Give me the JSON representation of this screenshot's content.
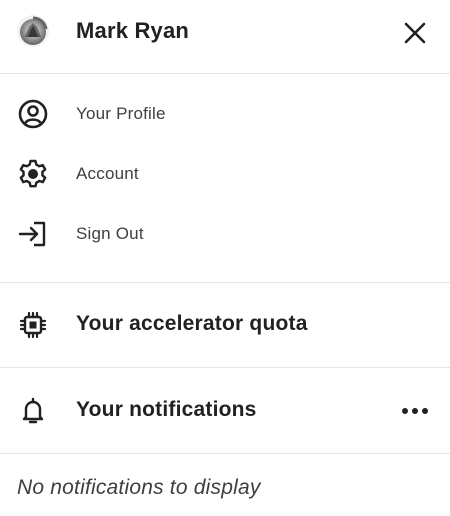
{
  "header": {
    "user_name": "Mark Ryan",
    "avatar_icon": "avatar-image",
    "close_icon": "close-icon"
  },
  "menu": {
    "items": [
      {
        "label": "Your Profile",
        "icon": "profile-icon"
      },
      {
        "label": "Account",
        "icon": "gear-icon"
      },
      {
        "label": "Sign Out",
        "icon": "sign-out-icon"
      }
    ]
  },
  "accelerator": {
    "title": "Your accelerator quota",
    "icon": "chip-icon"
  },
  "notifications": {
    "title": "Your notifications",
    "icon": "bell-icon",
    "more_icon": "more-horizontal-icon",
    "empty_message": "No notifications to display"
  },
  "colors": {
    "text_primary": "#202124",
    "text_secondary": "#3c4043",
    "divider": "#e6e6e6",
    "background": "#ffffff"
  }
}
